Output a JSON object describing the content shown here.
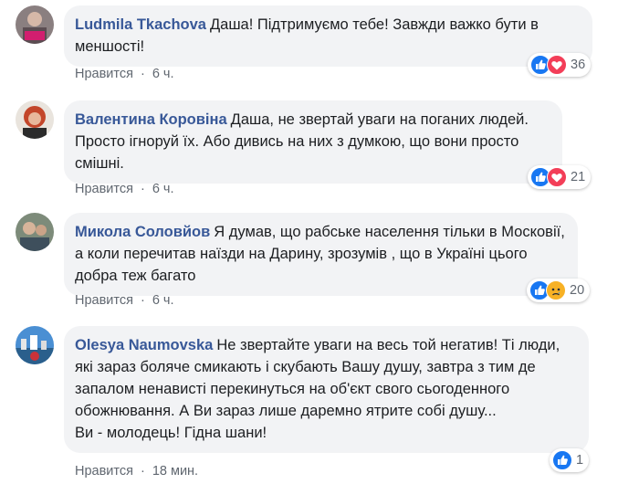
{
  "comments": [
    {
      "author": "Ludmila Tkachova",
      "text": "Даша! Підтримуємо тебе! Завжди важко бути в меншості!",
      "like_label": "Нравится",
      "time": "6 ч.",
      "reaction_count": "36",
      "reactions": [
        "like-icon",
        "love-icon"
      ]
    },
    {
      "author": "Валентина Коровіна",
      "text": "Даша, не звертай уваги на поганих людей. Просто ігноруй їх. Або дивись на них з думкою, що вони просто смішні.",
      "like_label": "Нравится",
      "time": "6 ч.",
      "reaction_count": "21",
      "reactions": [
        "like-icon",
        "love-icon"
      ]
    },
    {
      "author": "Микола Соловйов",
      "text": "Я думав, що рабське населення тільки в Московії, а коли перечитав наїзди на Дарину, зрозумів , що в Україні цього добра теж багато",
      "like_label": "Нравится",
      "time": "6 ч.",
      "reaction_count": "20",
      "reactions": [
        "like-icon",
        "sad-icon"
      ]
    },
    {
      "author": "Olesya Naumovska",
      "text": "Не звертайте уваги на весь той негатив! Ті люди, які зараз боляче смикають і скубають Вашу душу, завтра з тим де запалом ненависті перекинуться на об'єкт свого сьогоденного обожнювання. А Ви зараз лише даремно ятрите собі душу...",
      "text2": "Ви - молодець! Гідна шани!",
      "like_label": "Нравится",
      "time": "18 мин.",
      "reaction_count": "1",
      "reactions": [
        "like-icon"
      ]
    }
  ],
  "colors": {
    "author": "#385898",
    "bubble": "#f2f3f5",
    "meta": "#606770",
    "like": "#1877f2",
    "love": "#f33e58",
    "sad": "#f7b125"
  }
}
